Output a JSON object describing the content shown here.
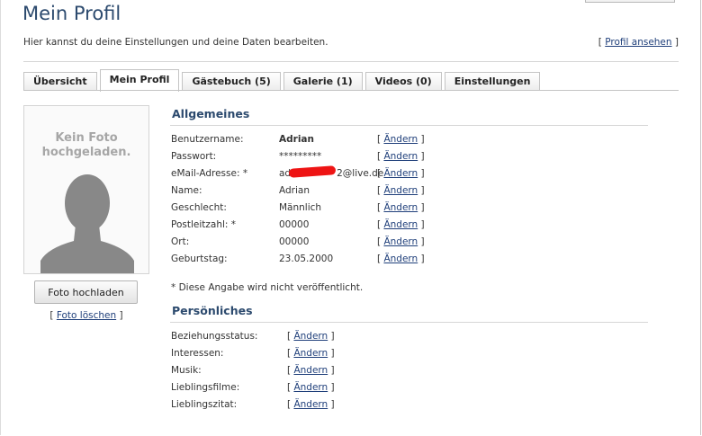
{
  "header": {
    "title": "Mein Profil",
    "subtitle": "Hier kannst du deine Einstellungen und deine Daten bearbeiten.",
    "profile_link": "Profil ansehen"
  },
  "tabs": [
    "Übersicht",
    "Mein Profil",
    "Gästebuch (5)",
    "Galerie (1)",
    "Videos (0)",
    "Einstellungen"
  ],
  "active_tab": "Mein Profil",
  "photo": {
    "placeholder_line1": "Kein Foto",
    "placeholder_line2": "hochgeladen.",
    "upload_button": "Foto hochladen",
    "delete_link": "Foto löschen"
  },
  "general": {
    "title": "Allgemeines",
    "edit_label": "Ändern",
    "fields": [
      {
        "label": "Benutzername:",
        "value": "Adrian"
      },
      {
        "label": "Passwort:",
        "value": "*********"
      },
      {
        "label": "eMail-Adresse: *",
        "value": "ad",
        "value_suffix": "2@live.de"
      },
      {
        "label": "Name:",
        "value": "Adrian"
      },
      {
        "label": "Geschlecht:",
        "value": "Männlich"
      },
      {
        "label": "Postleitzahl: *",
        "value": "00000"
      },
      {
        "label": "Ort:",
        "value": "00000"
      },
      {
        "label": "Geburtstag:",
        "value": "23.05.2000"
      }
    ],
    "footnote": "* Diese Angabe wird nicht veröffentlicht."
  },
  "personal": {
    "title": "Persönliches",
    "edit_label": "Ändern",
    "fields": [
      {
        "label": "Beziehungsstatus:"
      },
      {
        "label": "Interessen:"
      },
      {
        "label": "Musik:"
      },
      {
        "label": "Lieblingsfilme:"
      },
      {
        "label": "Lieblingszitat:"
      }
    ]
  },
  "colors": {
    "title": "#2c4a6e",
    "link": "#1f3f7a",
    "redaction": "#ee1414"
  }
}
